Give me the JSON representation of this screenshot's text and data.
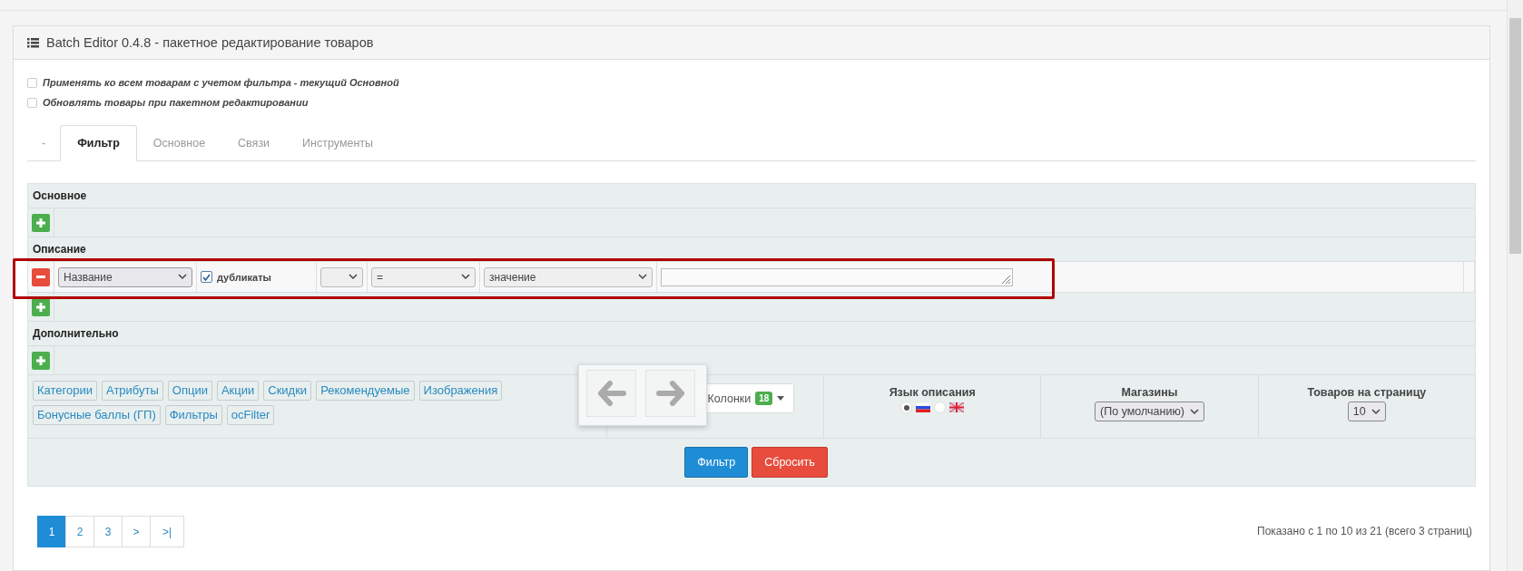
{
  "title": "Batch Editor 0.4.8 - пакетное редактирование товаров",
  "options": [
    {
      "label": "Применять ко всем товарам с учетом фильтра - текущий Основной",
      "checked": false
    },
    {
      "label": "Обновлять товары при пакетном редактировании",
      "checked": false
    }
  ],
  "tabs": [
    {
      "label": "-",
      "selected": false
    },
    {
      "label": "Фильтр",
      "selected": true
    },
    {
      "label": "Основное",
      "selected": false
    },
    {
      "label": "Связи",
      "selected": false
    },
    {
      "label": "Инструменты",
      "selected": false
    }
  ],
  "filter_sections": [
    {
      "title": "Основное"
    },
    {
      "title": "Описание",
      "rows": [
        {
          "field": "Название",
          "duplicates": {
            "label": "дубликаты",
            "checked": true
          },
          "operator": "=",
          "value_mode": "значение",
          "highlighted": true
        }
      ]
    },
    {
      "title": "Дополнительно"
    }
  ],
  "quick_tags": [
    "Категории",
    "Атрибуты",
    "Опции",
    "Акции",
    "Скидки",
    "Рекомендуемые",
    "Изображения",
    "Бонусные баллы (ГП)",
    "Фильтры",
    "ocFilter"
  ],
  "columns_button": {
    "label": "Колонки",
    "count": "18"
  },
  "language": {
    "label": "Язык описания",
    "options": [
      {
        "kind": "ru",
        "selected": true
      },
      {
        "kind": "en",
        "selected": false
      }
    ]
  },
  "stores": {
    "label": "Магазины",
    "value": "(По умолчанию)"
  },
  "per_page": {
    "label": "Товаров на страницу",
    "value": "10"
  },
  "actions": [
    {
      "label": "Фильтр",
      "kind": "primary"
    },
    {
      "label": "Сбросить",
      "kind": "danger"
    }
  ],
  "pagination": [
    {
      "label": "1",
      "selected": true
    },
    {
      "label": "2",
      "selected": false
    },
    {
      "label": "3",
      "selected": false
    },
    {
      "label": ">",
      "selected": false
    },
    {
      "label": ">|",
      "selected": false
    }
  ],
  "summary": "Показано с 1 по 10 из 21 (всего 3 страниц)"
}
